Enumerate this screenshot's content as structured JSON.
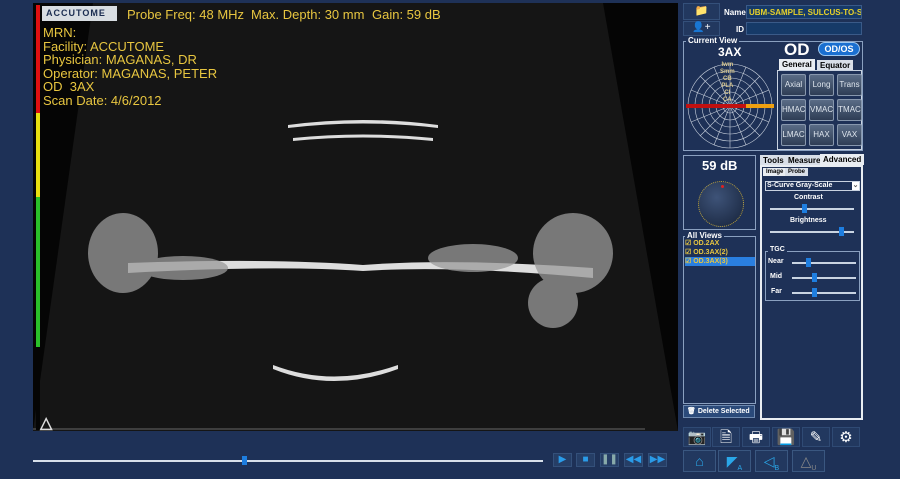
{
  "overlay": {
    "logo": "ACCUTOME",
    "probe_freq": "Probe Freq: 48 MHz",
    "max_depth": "Max. Depth: 30 mm",
    "gain": "Gain: 59 dB",
    "mrn": "MRN:",
    "facility": "Facility: ACCUTOME",
    "physician": "Physician: MAGANAS, DR",
    "operator": "Operator: MAGANAS, PETER",
    "view": "OD  3AX",
    "scan_date": "Scan Date: 4/6/2012"
  },
  "patient": {
    "name_label": "Name",
    "name_value": "UBM-SAMPLE, SULCUS-TO-SULC",
    "id_label": "ID",
    "id_value": ""
  },
  "current_view": {
    "legend": "Current View",
    "view": "3AX",
    "eye": "OD",
    "eye_toggle": "OD/OS",
    "radar_labels": [
      "Iwm",
      "Smm",
      "CB",
      "PLA",
      "CI",
      "CA"
    ],
    "tabs": [
      "General",
      "Equator"
    ],
    "buttons": [
      "Axial",
      "Long",
      "Trans",
      "HMAC",
      "VMAC",
      "TMAC",
      "LMAC",
      "HAX",
      "VAX"
    ]
  },
  "gain_panel": {
    "value": "59 dB"
  },
  "all_views": {
    "legend": "All Views",
    "items": [
      {
        "label": "OD.2AX",
        "selected": false
      },
      {
        "label": "OD.3AX(2)",
        "selected": false
      },
      {
        "label": "OD.3AX(3)",
        "selected": true
      }
    ],
    "delete": "Delete Selected"
  },
  "tools": {
    "tabs": [
      "Tools",
      "Measure",
      "Advanced"
    ],
    "subtabs": [
      "Image",
      "Probe"
    ],
    "colormap": "S-Curve Gray-Scale",
    "contrast_label": "Contrast",
    "contrast": 0.38,
    "brightness_label": "Brightness",
    "brightness": 0.82,
    "tgc_legend": "TGC",
    "near_label": "Near",
    "near": 0.22,
    "mid_label": "Mid",
    "mid": 0.31,
    "far_label": "Far",
    "far": 0.31
  },
  "playback": {
    "position": 0.41
  },
  "nav": {
    "a": "A",
    "b": "B",
    "u": "U"
  }
}
